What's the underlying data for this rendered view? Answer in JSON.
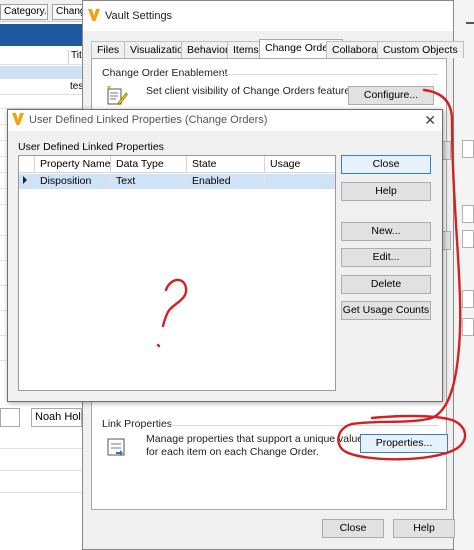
{
  "background_app": {
    "tab_category": "Category...",
    "tab_change": "Chang",
    "column_header": "Tit",
    "row_text": "tes",
    "assignee_value": "Noah Holwe"
  },
  "vault_settings": {
    "title": "Vault Settings",
    "tabs": [
      {
        "label": "Files"
      },
      {
        "label": "Visualization"
      },
      {
        "label": "Behaviors"
      },
      {
        "label": "Items"
      },
      {
        "label": "Change Orders"
      },
      {
        "label": "Collaborate"
      },
      {
        "label": "Custom Objects"
      }
    ],
    "active_tab": "Change Orders",
    "enablement": {
      "group_label": "Change Order Enablement",
      "description": "Set client visibility of Change Orders features",
      "button": "Configure..."
    },
    "link_properties": {
      "group_label": "Link Properties",
      "description_line1": "Manage properties that support a unique value",
      "description_line2": "for each item on each Change Order.",
      "button": "Properties..."
    },
    "footer": {
      "close": "Close",
      "help": "Help"
    }
  },
  "linked_properties_dialog": {
    "title": "User Defined Linked Properties (Change Orders)",
    "caption": "User Defined Linked Properties",
    "columns": [
      "Property Name",
      "Data Type",
      "State",
      "Usage"
    ],
    "rows": [
      {
        "property_name": "Disposition",
        "data_type": "Text",
        "state": "Enabled",
        "usage": ""
      }
    ],
    "buttons": {
      "close": "Close",
      "help": "Help",
      "new": "New...",
      "edit": "Edit...",
      "delete": "Delete",
      "usage_counts": "Get Usage Counts"
    }
  },
  "annotations": {
    "question_mark": "?",
    "ink_color": "#d42020"
  },
  "colors": {
    "vault_icon": "#f2a20b",
    "selection": "#cfe3f7",
    "background_header": "#1e5a9e"
  }
}
